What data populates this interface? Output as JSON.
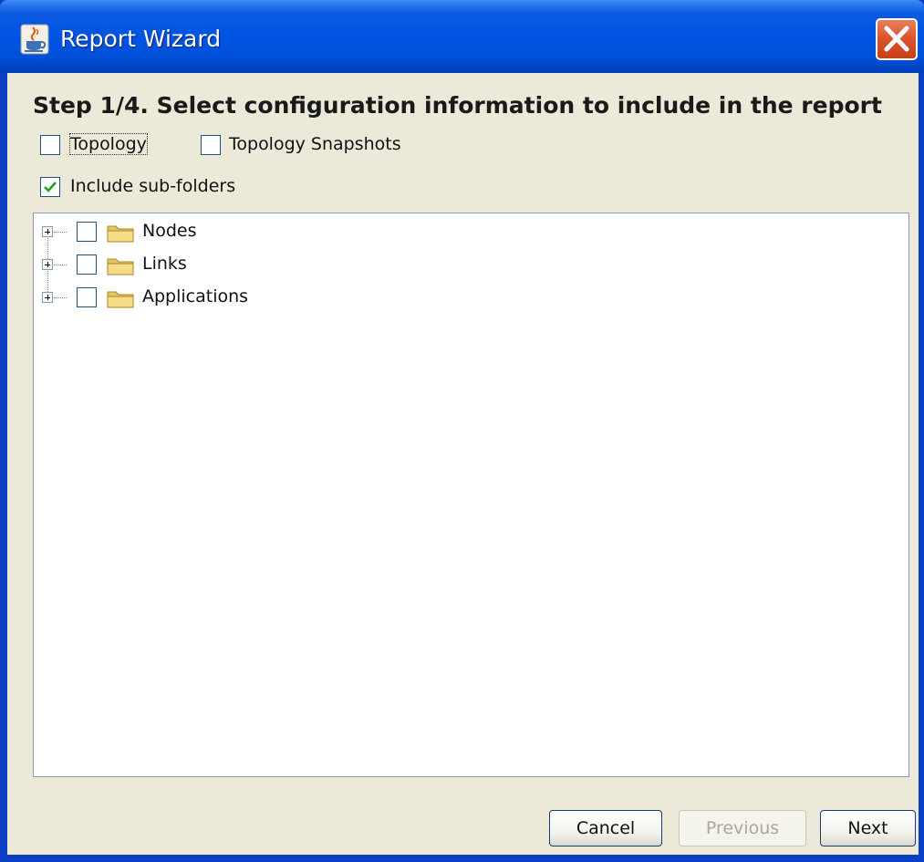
{
  "window": {
    "title": "Report Wizard",
    "app_icon": "java-cup-icon",
    "close_icon": "close-x-icon"
  },
  "wizard": {
    "heading": "Step 1/4. Select configuration information to include in the report"
  },
  "options": {
    "topology": {
      "label": "Topology",
      "checked": false
    },
    "topology_snapshots": {
      "label": "Topology Snapshots",
      "checked": false
    },
    "include_subfolders": {
      "label": "Include sub-folders",
      "checked": true
    }
  },
  "tree": {
    "nodes": [
      {
        "label": "Nodes",
        "checked": false,
        "expanded": false,
        "icon": "folder-icon"
      },
      {
        "label": "Links",
        "checked": false,
        "expanded": false,
        "icon": "folder-icon"
      },
      {
        "label": "Applications",
        "checked": false,
        "expanded": false,
        "icon": "folder-icon"
      }
    ]
  },
  "buttons": {
    "cancel": {
      "label": "Cancel",
      "enabled": true
    },
    "previous": {
      "label": "Previous",
      "enabled": false
    },
    "next": {
      "label": "Next",
      "enabled": true
    }
  },
  "colors": {
    "titlebar": "#0054e3",
    "client_bg": "#ece9d8",
    "check_mark": "#21a121",
    "close_btn": "#d9522a"
  }
}
